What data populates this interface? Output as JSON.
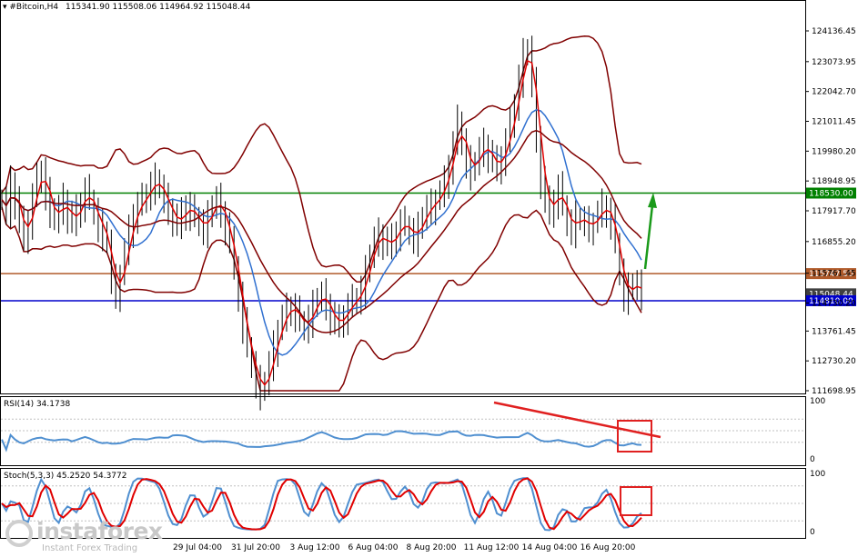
{
  "header": {
    "symbol": "#Bitcoin,H4",
    "ohlc": "115341.90 115508.06 114964.92 115048.44"
  },
  "rsi": {
    "label": "RSI(14) 34.1738",
    "level_max": "100",
    "level_min": "0"
  },
  "stoch": {
    "label": "Stoch(5,3,3) 45.2520 54.3772",
    "level_max": "100",
    "level_min": "0"
  },
  "logo": {
    "main": "instaforex",
    "sub": "Instant Forex Trading"
  },
  "colors": {
    "price": "#000000",
    "bands": "#800000",
    "ma_fast": "#e00000",
    "ma_slow": "#3070d0",
    "green_level": "#008000",
    "orange_level": "#b05a2a",
    "blue_level": "#0000cc",
    "indicator_line": "#4f8fd0",
    "annotation": "#e02020",
    "arrow": "#1a9a1a"
  },
  "chart_data": {
    "type": "line",
    "title": "#Bitcoin,H4",
    "price_ticks": [
      "124136.45",
      "123073.95",
      "122042.70",
      "121011.45",
      "119980.20",
      "118948.95",
      "117917.70",
      "116855.20",
      "115761.45",
      "114730.20",
      "113761.45",
      "112730.20",
      "111698.95"
    ],
    "time_labels": [
      "29 Jul 04:00",
      "31 Jul 20:00",
      "3 Aug 12:00",
      "6 Aug 04:00",
      "8 Aug 20:00",
      "11 Aug 12:00",
      "14 Aug 04:00",
      "16 Aug 20:00"
    ],
    "levels": [
      {
        "label": "118530.00",
        "value": 118530,
        "color": "#008000"
      },
      {
        "label": "115747.50",
        "value": 115747.5,
        "color": "#b05a2a"
      },
      {
        "label": "115048.44",
        "value": 115048.44,
        "color": "#404040"
      },
      {
        "label": "114810.00",
        "value": 114810,
        "color": "#0000cc"
      }
    ],
    "close_approx": [
      118300,
      117900,
      118900,
      118300,
      117500,
      117000,
      117600,
      118400,
      119000,
      119300,
      118500,
      118000,
      117600,
      118000,
      118300,
      117800,
      117500,
      117900,
      118200,
      118600,
      118300,
      117900,
      117400,
      117200,
      116800,
      115500,
      115100,
      115700,
      116500,
      117200,
      117800,
      118100,
      118300,
      118500,
      118800,
      119000,
      118700,
      118300,
      118000,
      117700,
      117400,
      117800,
      118100,
      117900,
      117700,
      117500,
      117300,
      117700,
      118100,
      118300,
      117900,
      117400,
      116800,
      116000,
      115000,
      114000,
      113200,
      112600,
      112000,
      111700,
      112000,
      112600,
      113200,
      113800,
      114200,
      114500,
      114600,
      114400,
      114100,
      113900,
      114200,
      114600,
      114900,
      115000,
      114700,
      114300,
      114000,
      114100,
      114300,
      114600,
      114800,
      114900,
      115200,
      115800,
      116400,
      116900,
      117100,
      116900,
      116700,
      116900,
      117200,
      117500,
      117400,
      117200,
      117000,
      117300,
      117700,
      118000,
      118100,
      118300,
      118500,
      118900,
      119500,
      120200,
      121000,
      120300,
      119600,
      119300,
      119600,
      120000,
      120200,
      119900,
      119600,
      119400,
      119800,
      120300,
      120900,
      121600,
      122500,
      123300,
      123500,
      122300,
      120500,
      119000,
      118200,
      117900,
      118300,
      118700,
      118100,
      117500,
      117300,
      117700,
      117600,
      117500,
      117400,
      117500,
      117800,
      118100,
      117900,
      117600,
      116800,
      115800,
      115000,
      115200,
      115400,
      115300,
      115048
    ],
    "ylim": [
      111698.95,
      124500
    ]
  }
}
